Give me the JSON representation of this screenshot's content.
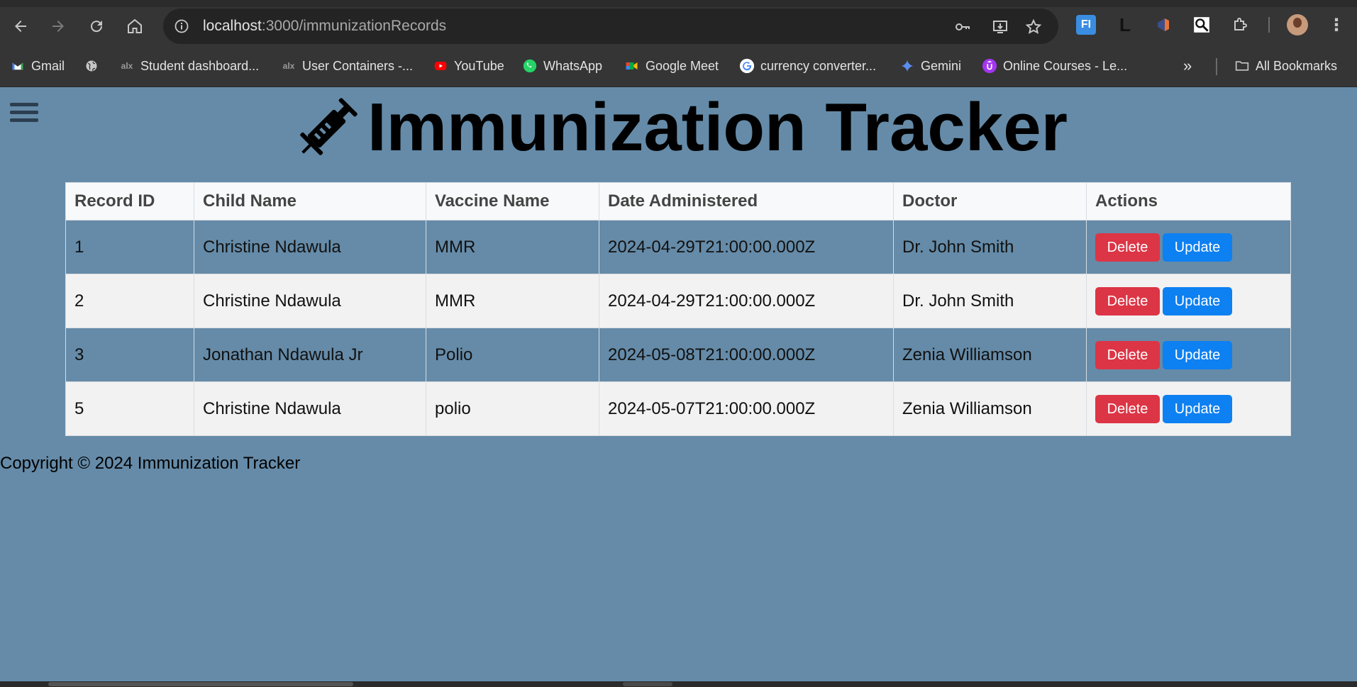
{
  "browser": {
    "url_host": "localhost",
    "url_path": ":3000/immunizationRecords",
    "bookmarks": [
      {
        "label": "Gmail",
        "icon": "gmail-icon"
      },
      {
        "label": "",
        "icon": "globe-icon"
      },
      {
        "label": "Student dashboard...",
        "icon": "alx-icon"
      },
      {
        "label": "User Containers -...",
        "icon": "alx-icon"
      },
      {
        "label": "YouTube",
        "icon": "youtube-icon"
      },
      {
        "label": "WhatsApp",
        "icon": "whatsapp-icon"
      },
      {
        "label": "Google Meet",
        "icon": "google-meet-icon"
      },
      {
        "label": "currency converter...",
        "icon": "google-icon"
      },
      {
        "label": "Gemini",
        "icon": "gemini-icon"
      },
      {
        "label": "Online Courses - Le...",
        "icon": "udemy-icon"
      }
    ],
    "more_bookmarks": "»",
    "all_bookmarks": "All Bookmarks"
  },
  "page": {
    "title": "Immunization Tracker",
    "footer": "Copyright © 2024 Immunization Tracker"
  },
  "table": {
    "headers": [
      "Record ID",
      "Child Name",
      "Vaccine Name",
      "Date Administered",
      "Doctor",
      "Actions"
    ],
    "rows": [
      {
        "id": "1",
        "child": "Christine Ndawula",
        "vaccine": "MMR",
        "date": "2024-04-29T21:00:00.000Z",
        "doctor": "Dr. John Smith"
      },
      {
        "id": "2",
        "child": "Christine Ndawula",
        "vaccine": "MMR",
        "date": "2024-04-29T21:00:00.000Z",
        "doctor": "Dr. John Smith"
      },
      {
        "id": "3",
        "child": "Jonathan Ndawula Jr",
        "vaccine": "Polio",
        "date": "2024-05-08T21:00:00.000Z",
        "doctor": "Zenia Williamson"
      },
      {
        "id": "5",
        "child": "Christine Ndawula",
        "vaccine": "polio",
        "date": "2024-05-07T21:00:00.000Z",
        "doctor": "Zenia Williamson"
      }
    ],
    "delete_label": "Delete",
    "update_label": "Update"
  },
  "colors": {
    "page_background": "#658ba8",
    "delete_button": "#dc3545",
    "update_button": "#0d80f2"
  }
}
